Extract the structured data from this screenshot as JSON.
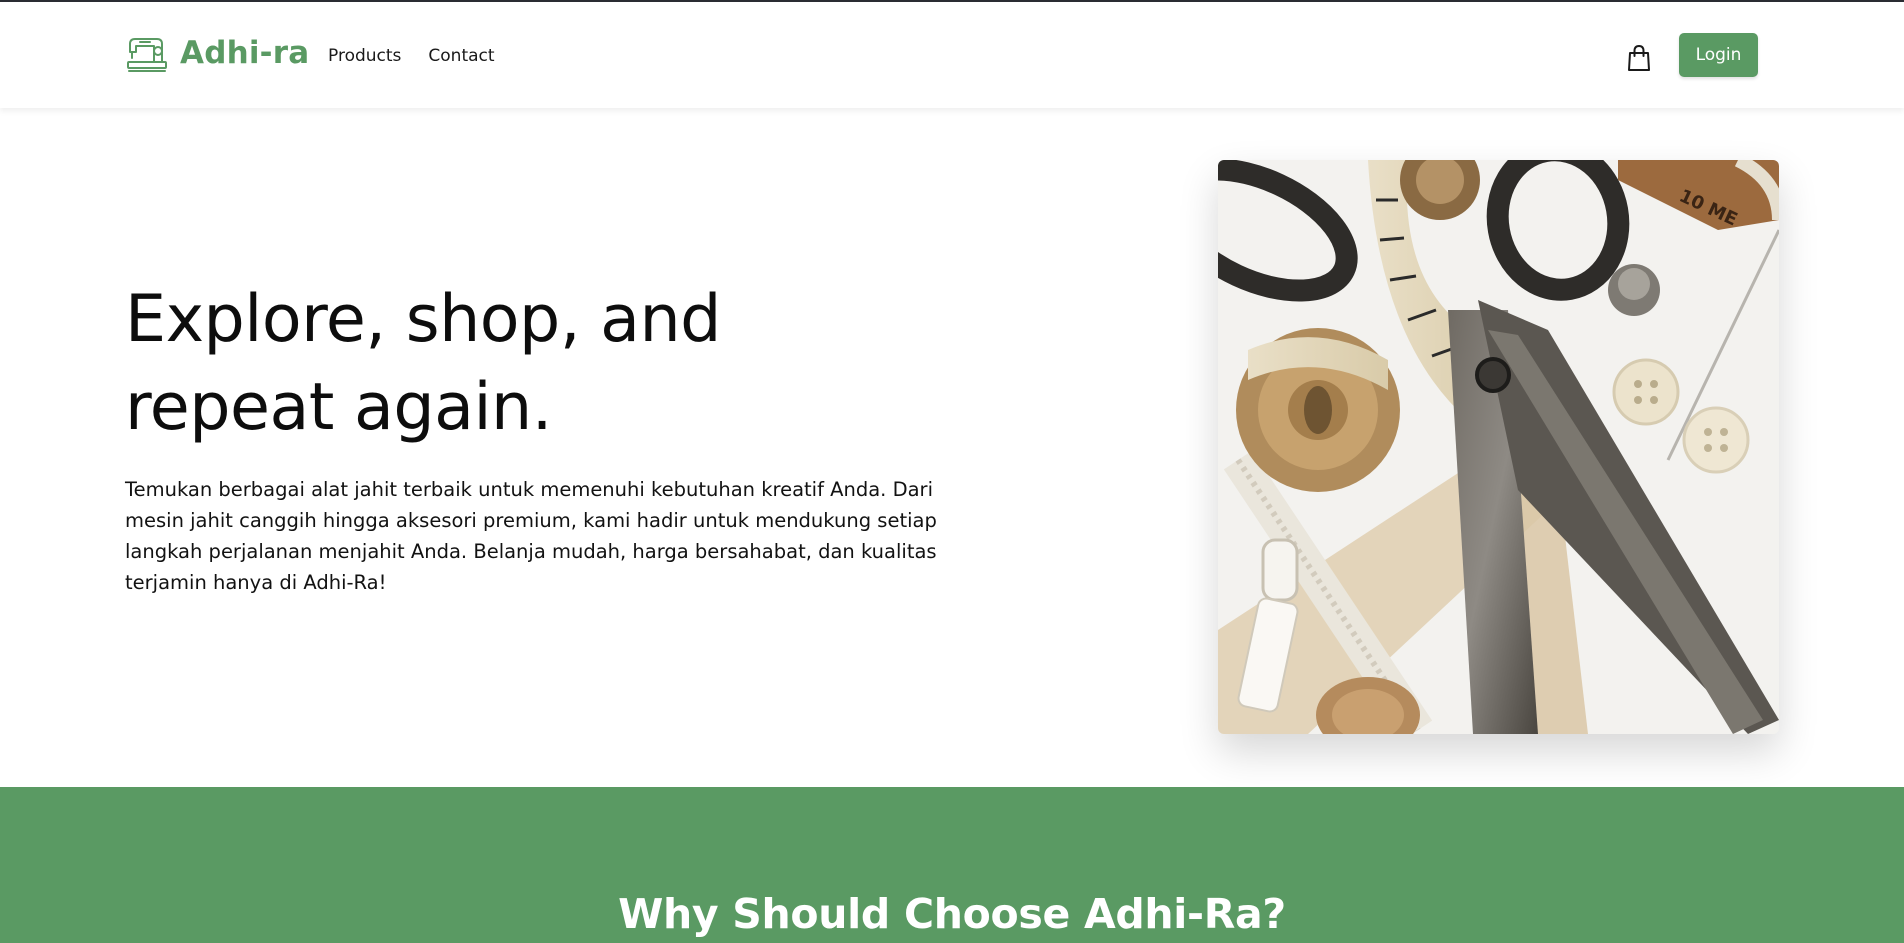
{
  "header": {
    "brand_name": "Adhi-ra",
    "logo_icon": "sewing-machine-icon",
    "nav": [
      {
        "label": "Products"
      },
      {
        "label": "Contact"
      }
    ],
    "cart_icon": "shopping-bag-icon",
    "login_label": "Login"
  },
  "hero": {
    "title_line1": "Explore, shop, and",
    "title_line2": "repeat again.",
    "description": "Temukan berbagai alat jahit terbaik untuk memenuhi kebutuhan kreatif Anda. Dari mesin jahit canggih hingga aksesori premium, kami hadir untuk mendukung setiap langkah perjalanan menjahit Anda. Belanja mudah, harga bersahabat, dan kualitas terjamin hanya di Adhi-Ra!",
    "image_subject": "sewing tools: scissors, tape measure, buttons, zipper, thimble"
  },
  "why": {
    "title": "Why Should Choose Adhi-Ra?"
  },
  "colors": {
    "brand_green": "#5a9a63",
    "text_dark": "#0d0d0d",
    "background": "#ffffff"
  }
}
